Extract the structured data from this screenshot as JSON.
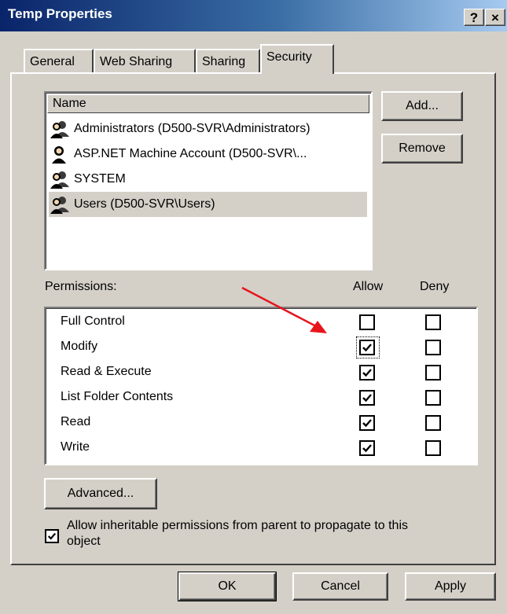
{
  "window": {
    "title": "Temp Properties",
    "help_glyph": "?",
    "close_glyph": "×"
  },
  "tabs": [
    "General",
    "Web Sharing",
    "Sharing",
    "Security"
  ],
  "active_tab": "Security",
  "names_list": {
    "header": "Name",
    "items": [
      {
        "label": "Administrators (D500-SVR\\Administrators)",
        "icon": "group-users-icon",
        "selected": false
      },
      {
        "label": "ASP.NET Machine Account (D500-SVR\\...",
        "icon": "user-icon",
        "selected": false
      },
      {
        "label": "SYSTEM",
        "icon": "group-users-icon",
        "selected": false
      },
      {
        "label": "Users (D500-SVR\\Users)",
        "icon": "group-users-icon",
        "selected": true
      }
    ]
  },
  "buttons": {
    "add": "Add...",
    "remove": "Remove",
    "advanced": "Advanced...",
    "ok": "OK",
    "cancel": "Cancel",
    "apply": "Apply"
  },
  "permissions": {
    "label": "Permissions:",
    "allow_header": "Allow",
    "deny_header": "Deny",
    "rows": [
      {
        "name": "Full Control",
        "allow": false,
        "deny": false
      },
      {
        "name": "Modify",
        "allow": true,
        "deny": false,
        "focused": true
      },
      {
        "name": "Read & Execute",
        "allow": true,
        "deny": false
      },
      {
        "name": "List Folder Contents",
        "allow": true,
        "deny": false
      },
      {
        "name": "Read",
        "allow": true,
        "deny": false
      },
      {
        "name": "Write",
        "allow": true,
        "deny": false
      }
    ]
  },
  "inherit": {
    "checked": true,
    "line1": "Allow inheritable permissions from parent to propagate to this",
    "line2": "object"
  },
  "annotation": {
    "arrow_color": "#e8141b"
  },
  "colors": {
    "dialog_bg": "#d4d0c8",
    "titlebar_start": "#0a246a",
    "titlebar_end": "#a6caf0"
  }
}
